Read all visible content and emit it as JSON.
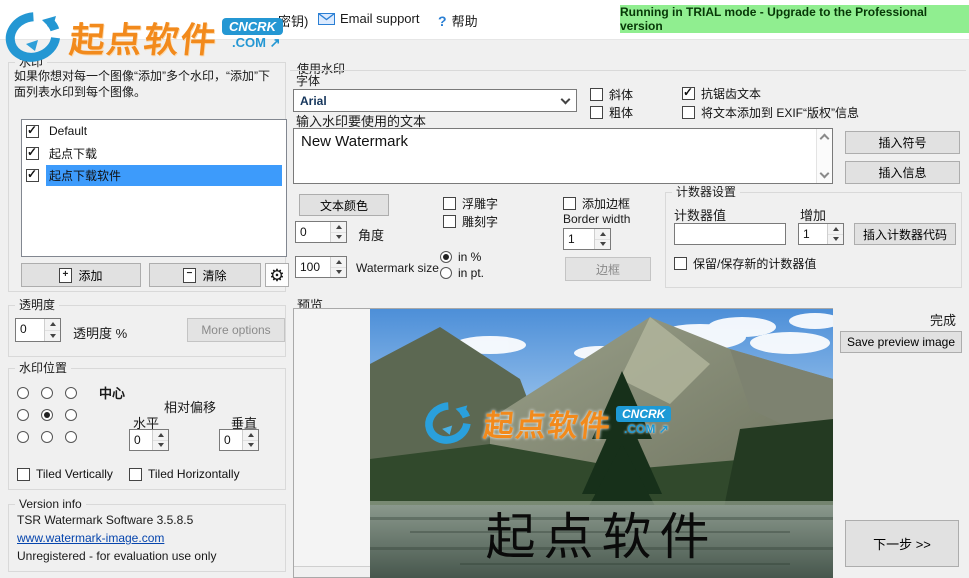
{
  "header": {
    "partial_menu": "密钥)",
    "email_support": "Email support",
    "help": "帮助",
    "trial_banner": "Running in TRIAL mode - Upgrade to the Professional version",
    "logo": {
      "text": "起点软件",
      "badge": "CNCRK",
      "domain": ".COM",
      "arrow": "↗"
    }
  },
  "watermark_group": {
    "title": "水印",
    "description": "如果你想对每一个图像“添加”多个水印，“添加”下面列表水印到每个图像。",
    "items": [
      {
        "label": "Default",
        "checked": true,
        "selected": false
      },
      {
        "label": "起点下载",
        "checked": true,
        "selected": false
      },
      {
        "label": "起点下载软件",
        "checked": true,
        "selected": true
      }
    ],
    "add_button": "添加",
    "clear_button": "清除"
  },
  "opacity_group": {
    "title": "透明度",
    "value": "0",
    "suffix_label": "透明度 %",
    "more_options_button": "More options"
  },
  "position_group": {
    "title": "水印位置",
    "center_label": "中心",
    "offset_label": "相对偏移",
    "horizontal_label": "水平",
    "horizontal_value": "0",
    "vertical_label": "垂直",
    "vertical_value": "0",
    "tiled_vertically": "Tiled Vertically",
    "tiled_horizontally": "Tiled Horizontally"
  },
  "version_group": {
    "title": "Version info",
    "software": "TSR Watermark Software 3.5.8.5",
    "website": "www.watermark-image.com",
    "license": "Unregistered - for evaluation use only"
  },
  "use_watermark_group": {
    "title": "使用水印",
    "font_label": "字体",
    "font_value": "Arial",
    "italic": "斜体",
    "bold": "粗体",
    "antialias": "抗锯齿文本",
    "exif": "将文本添加到 EXIF“版权”信息",
    "input_label": "输入水印要使用的文本",
    "text_value": "New Watermark",
    "insert_symbol_button": "插入符号",
    "insert_info_button": "插入信息",
    "text_color_button": "文本颜色",
    "emboss": "浮雕字",
    "engrave": "雕刻字",
    "add_border": "添加边框",
    "border_width_label": "Border width",
    "border_width_value": "1",
    "angle_value": "0",
    "angle_label": "角度",
    "size_value": "100",
    "size_label": "Watermark size",
    "in_percent": "in %",
    "in_pt": "in pt.",
    "border_button": "边框"
  },
  "counter_group": {
    "title": "计数器设置",
    "value_label": "计数器值",
    "increment_label": "增加",
    "increment_value": "1",
    "insert_code_button": "插入计数器代码",
    "keep_value": "保留/保存新的计数器值"
  },
  "preview_group": {
    "title": "预览",
    "done_label": "完成",
    "save_button": "Save preview image",
    "next_button": "下一步 >>",
    "watermark_text": "起点软件",
    "watermark_badge": "CNCRK",
    "watermark_domain": ".COM",
    "watermark_arrow": "↗",
    "watermark_bottom_text": "起点软件"
  },
  "colors": {
    "accent_blue": "#2497d3",
    "logo_orange": "#f28a1c",
    "selection_blue": "#3d9bfb",
    "banner_green": "#90ee90",
    "link_blue": "#0645ad"
  }
}
